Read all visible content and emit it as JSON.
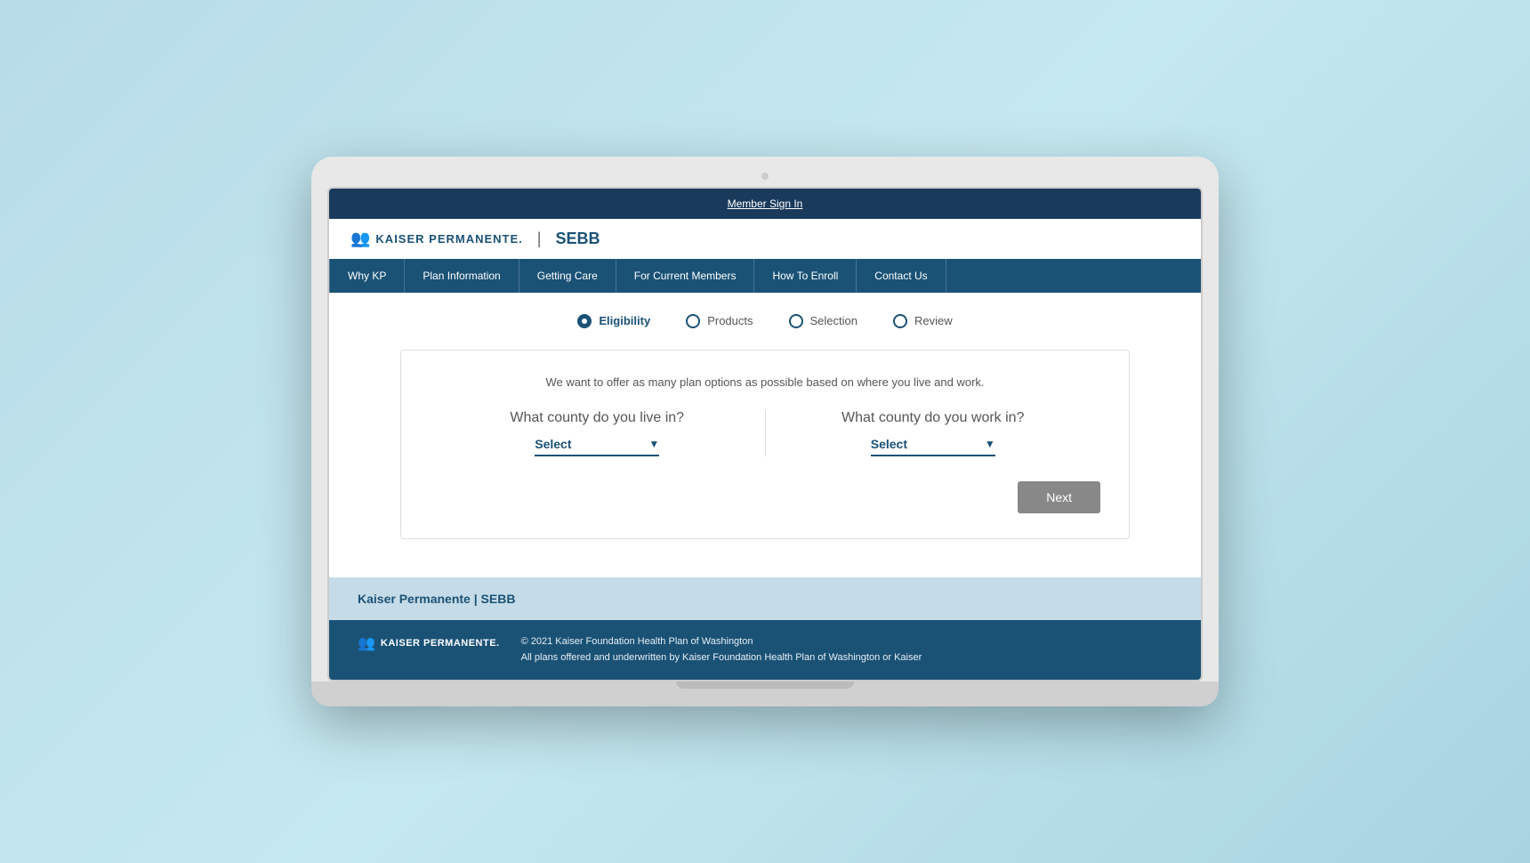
{
  "topbar": {
    "signin_label": "Member Sign In"
  },
  "logo": {
    "kp_text": "KAISER PERMANENTE.",
    "divider": "|",
    "sebb": "SEBB"
  },
  "nav": {
    "items": [
      {
        "label": "Why KP"
      },
      {
        "label": "Plan Information"
      },
      {
        "label": "Getting Care"
      },
      {
        "label": "For Current Members"
      },
      {
        "label": "How To Enroll"
      },
      {
        "label": "Contact Us"
      }
    ]
  },
  "steps": [
    {
      "label": "Eligibility",
      "active": true
    },
    {
      "label": "Products",
      "active": false
    },
    {
      "label": "Selection",
      "active": false
    },
    {
      "label": "Review",
      "active": false
    }
  ],
  "form": {
    "intro": "We want to offer as many plan options as possible based on where you live and work.",
    "live_question": "What county do you live in?",
    "work_question": "What county do you work in?",
    "live_select_label": "Select",
    "work_select_label": "Select",
    "next_button": "Next"
  },
  "footer": {
    "light_text": "Kaiser Permanente | SEBB",
    "copyright": "© 2021 Kaiser Foundation Health Plan of Washington",
    "underwritten": "All plans offered and underwritten by Kaiser Foundation Health Plan of Washington or Kaiser",
    "kp_logo_text": "KAISER PERMANENTE."
  }
}
